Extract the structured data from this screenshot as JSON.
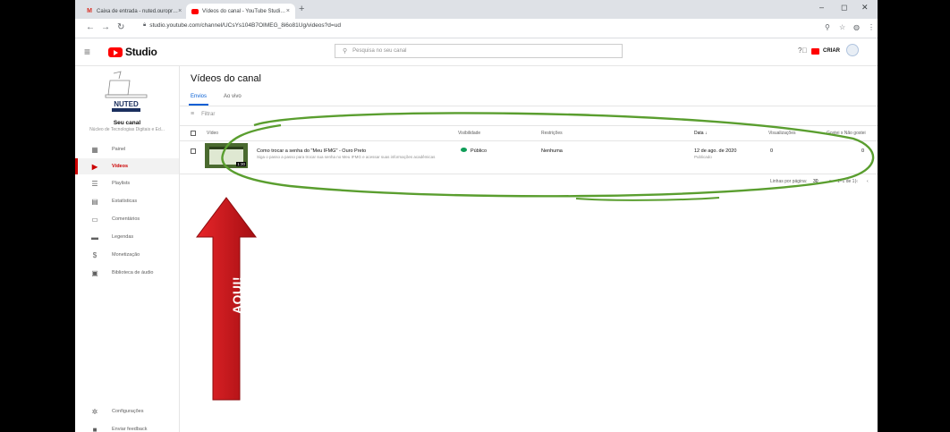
{
  "browser": {
    "tabs": [
      {
        "favicon": "M",
        "title": "Caixa de entrada - nuted.ouropr…",
        "close": "×"
      },
      {
        "favicon": "youtube-icon",
        "title": "Vídeos do canal - YouTube Studi…",
        "close": "×"
      }
    ],
    "new_tab": "+",
    "url": "studio.youtube.com/channel/UCsYs104B7OIMEG_8i6o81Ug/videos?d=ud",
    "window_controls": {
      "minimize": "–",
      "maximize": "◻",
      "close": "✕"
    }
  },
  "header": {
    "logo_text": "Studio",
    "search_placeholder": "Pesquisa no seu canal",
    "create_label": "CRIAR"
  },
  "sidebar": {
    "channel_logo_text": "NUTED",
    "channel_name": "Seu canal",
    "channel_subtitle": "Núcleo de Tecnologias Digitais e Ed...",
    "items": [
      {
        "label": "Painel",
        "icon": "dashboard-icon"
      },
      {
        "label": "Vídeos",
        "icon": "video-icon",
        "active": true
      },
      {
        "label": "Playlists",
        "icon": "playlist-icon"
      },
      {
        "label": "Estatísticas",
        "icon": "analytics-icon"
      },
      {
        "label": "Comentários",
        "icon": "comments-icon"
      },
      {
        "label": "Legendas",
        "icon": "subtitles-icon"
      },
      {
        "label": "Monetização",
        "icon": "dollar-icon"
      },
      {
        "label": "Biblioteca de áudio",
        "icon": "audio-library-icon"
      }
    ],
    "bottom_items": [
      {
        "label": "Configurações",
        "icon": "gear-icon"
      },
      {
        "label": "Enviar feedback",
        "icon": "feedback-icon"
      }
    ]
  },
  "main": {
    "title": "Vídeos do canal",
    "tabs": [
      "Envios",
      "Ao vivo"
    ],
    "filter_placeholder": "Filtrar",
    "columns": {
      "video": "Vídeo",
      "visibility": "Visibilidade",
      "restrictions": "Restrições",
      "date": "Data ↓",
      "views": "Visualizações",
      "likes": "Gostei x Não gostei"
    },
    "videos": [
      {
        "title": "Como trocar a senha do \"Meu IFMG\" - Ouro Preto",
        "description": "Siga o passo a passo para trocar sua senha no Meu IFMG e acessar suas informações acadêmicas",
        "duration": "1:30",
        "visibility": "Público",
        "restrictions": "Nenhuma",
        "date": "12 de ago. de 2020",
        "date_status": "Publicado",
        "views": "0",
        "comments": "0",
        "likes": "-"
      }
    ],
    "pagination": {
      "rows_label": "Linhas por página:",
      "rows_value": "30",
      "range": "1–1 de 1"
    }
  },
  "annotation": {
    "arrow_text": "AQUI!",
    "arrow_color": "#d0161b",
    "ellipse_color": "#5a9e2f"
  }
}
